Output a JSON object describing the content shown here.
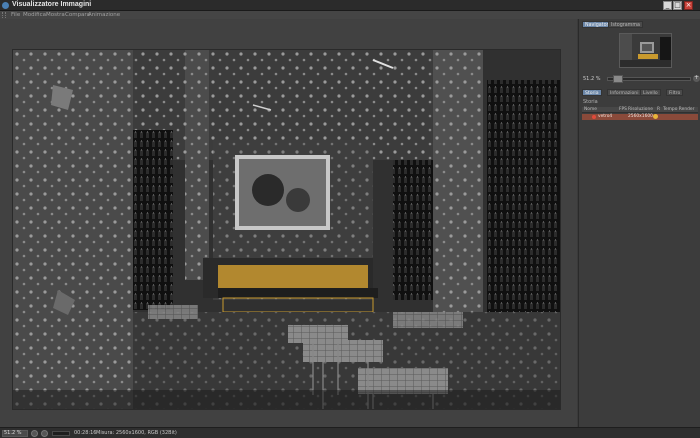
{
  "window": {
    "title": "Visualizzatore Immagini",
    "buttons": {
      "minimize": "_",
      "maximize": "□",
      "close": "×"
    }
  },
  "menu": {
    "items": [
      "File",
      "Modifica",
      "Mostra",
      "Compara",
      "Animazione"
    ]
  },
  "panel": {
    "top_tabs": [
      "Navigatore",
      "Istogramma"
    ],
    "active_top_tab": "Navigatore",
    "zoom_value": "51.2 %",
    "zoom_button": "+",
    "history_tabs": [
      "Storia",
      "Informazioni",
      "Livello",
      "Filtro"
    ],
    "active_history_tab": "Storia",
    "section_label": "Storia",
    "columns": [
      "Nome",
      "FPS",
      "Risoluzione",
      "R",
      "Tempo Render"
    ],
    "rows": [
      {
        "name": "vetro4",
        "fps": "",
        "resolution": "2560x1600",
        "r": "",
        "time": ""
      }
    ]
  },
  "status": {
    "zoom": "51.2 %",
    "time": "00:28:16",
    "info": "Misura: 2560x1600, RGB (32Bit)"
  },
  "colors": {
    "accent": "#6a86a8",
    "history_row": "#8a4a3a",
    "render_lights": "#e0a832"
  }
}
